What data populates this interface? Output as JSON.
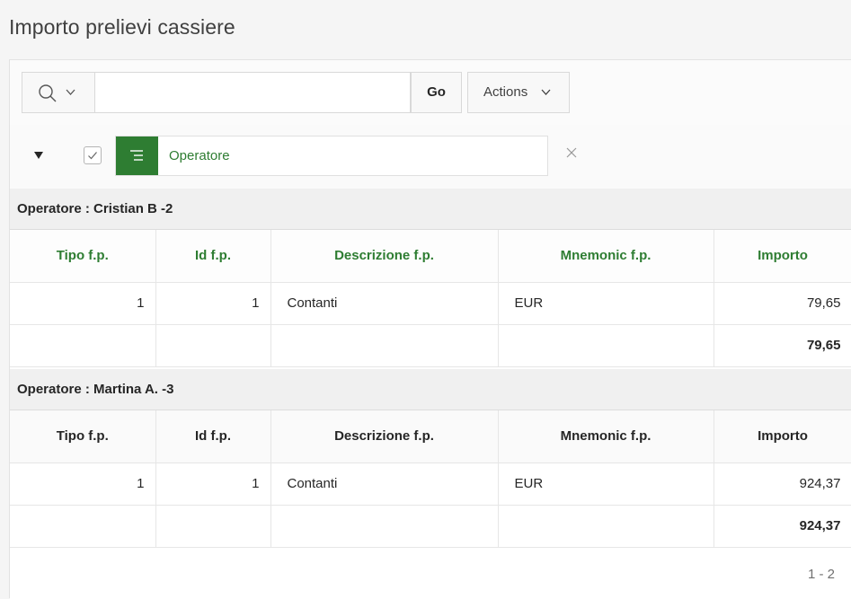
{
  "page": {
    "title": "Importo prelievi cassiere"
  },
  "toolbar": {
    "search_value": "",
    "go_label": "Go",
    "actions_label": "Actions"
  },
  "filter": {
    "label": "Operatore"
  },
  "columns": [
    "Tipo f.p.",
    "Id f.p.",
    "Descrizione f.p.",
    "Mnemonic f.p.",
    "Importo"
  ],
  "groups": [
    {
      "header": "Operatore : Cristian B -2",
      "rows": [
        {
          "tipo": "1",
          "id": "1",
          "descrizione": "Contanti",
          "mnemonic": "EUR",
          "importo": "79,65"
        }
      ],
      "total": "79,65"
    },
    {
      "header": "Operatore : Martina A. -3",
      "rows": [
        {
          "tipo": "1",
          "id": "1",
          "descrizione": "Contanti",
          "mnemonic": "EUR",
          "importo": "924,37"
        }
      ],
      "total": "924,37"
    }
  ],
  "pagination": {
    "range": "1 - 2"
  },
  "colors": {
    "accent": "#2e7d32",
    "header_text": "#262626"
  },
  "icons": [
    "search-icon",
    "chevron-down-icon",
    "triangle-down-icon",
    "checkmark-icon",
    "filter-list-icon",
    "close-icon"
  ]
}
